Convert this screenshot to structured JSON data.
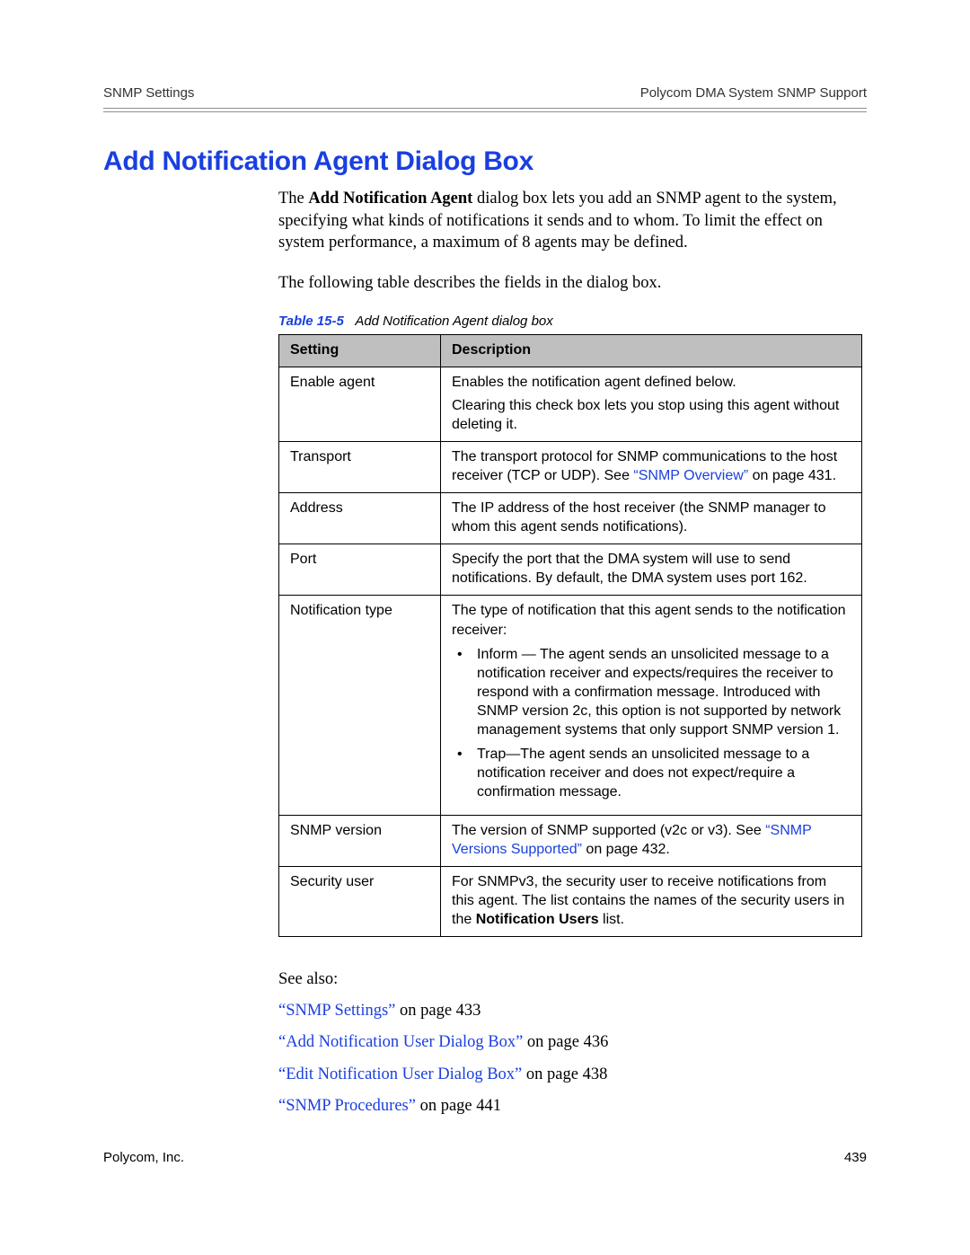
{
  "header": {
    "left": "SNMP Settings",
    "right": "Polycom DMA System SNMP Support"
  },
  "title": "Add Notification Agent Dialog Box",
  "intro": {
    "p1_a": "The ",
    "p1_bold": "Add Notification Agent",
    "p1_b": " dialog box lets you add an SNMP agent to the system, specifying what kinds of notifications it sends and to whom. To limit the effect on system performance, a maximum of 8 agents may be defined.",
    "p2": "The following table describes the fields in the dialog box."
  },
  "table": {
    "caption_label": "Table 15-5",
    "caption_text": "Add Notification Agent dialog box",
    "headers": {
      "setting": "Setting",
      "description": "Description"
    },
    "rows": {
      "enable_agent": {
        "setting": "Enable agent",
        "line1": "Enables the notification agent defined below.",
        "line2": "Clearing this check box lets you stop using this agent without deleting it."
      },
      "transport": {
        "setting": "Transport",
        "pre": "The transport protocol for SNMP communications to the host receiver (TCP or UDP). See ",
        "link": "“SNMP Overview”",
        "post": " on page 431."
      },
      "address": {
        "setting": "Address",
        "text": "The IP address of the host receiver (the SNMP manager to whom this agent sends notifications)."
      },
      "port": {
        "setting": "Port",
        "text": "Specify the port that the DMA system will use to send notifications. By default, the DMA system uses port 162."
      },
      "notification_type": {
        "setting": "Notification type",
        "lead": "The type of notification that this agent sends to the notification receiver:",
        "b1": "Inform — The agent sends an unsolicited message to a notification receiver and expects/requires the receiver to respond with a confirmation message. Introduced with SNMP version 2c, this option is not supported by network management systems that only support SNMP version 1.",
        "b2": "Trap—The agent sends an unsolicited message to a notification receiver and does not expect/require a confirmation message."
      },
      "snmp_version": {
        "setting": "SNMP version",
        "pre": "The version of SNMP supported (v2c or v3). See ",
        "link": "“SNMP Versions Supported”",
        "post": " on page 432."
      },
      "security_user": {
        "setting": "Security user",
        "pre": "For SNMPv3, the security user to receive notifications from this agent. The list contains the names of the security users in the ",
        "bold": "Notification Users",
        "post": " list."
      }
    }
  },
  "see_also": {
    "label": "See also:",
    "items": {
      "i1": {
        "link": "“SNMP Settings”",
        "rest": " on page 433"
      },
      "i2": {
        "link": "“Add Notification User Dialog Box”",
        "rest": " on page 436"
      },
      "i3": {
        "link": "“Edit Notification User Dialog Box”",
        "rest": " on page 438"
      },
      "i4": {
        "link": "“SNMP Procedures”",
        "rest": " on page 441"
      }
    }
  },
  "footer": {
    "left": "Polycom, Inc.",
    "right": "439"
  }
}
